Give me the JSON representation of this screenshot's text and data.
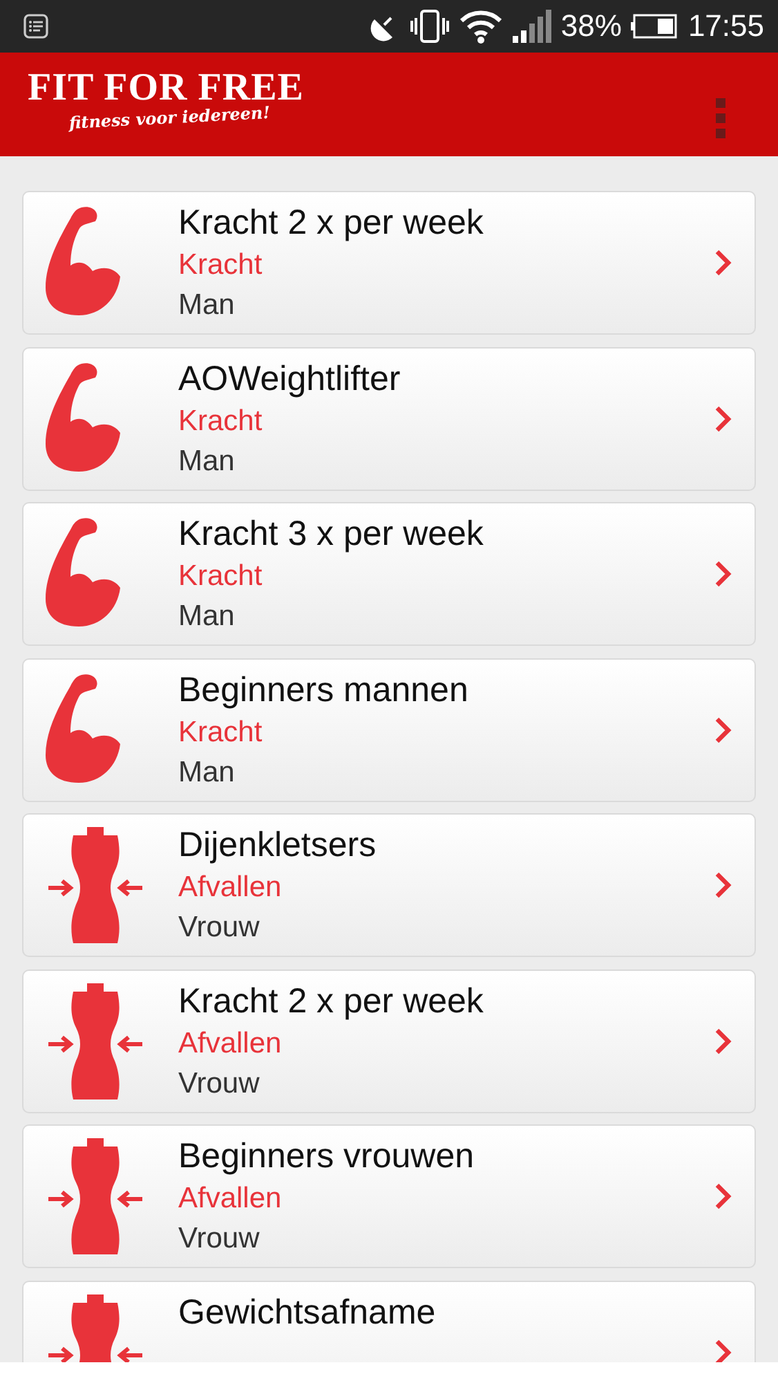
{
  "status_bar": {
    "battery": "38%",
    "time": "17:55"
  },
  "header": {
    "logo": "FIT FOR FREE",
    "tagline": "fitness voor iedereen!"
  },
  "programs": [
    {
      "kind": "muscle",
      "title": "Kracht 2 x per week",
      "category": "Kracht",
      "audience": "Man"
    },
    {
      "kind": "muscle",
      "title": "AOWeightlifter",
      "category": "Kracht",
      "audience": "Man"
    },
    {
      "kind": "muscle",
      "title": "Kracht 3 x per week",
      "category": "Kracht",
      "audience": "Man"
    },
    {
      "kind": "muscle",
      "title": "Beginners mannen",
      "category": "Kracht",
      "audience": "Man"
    },
    {
      "kind": "torso",
      "title": "Dijenkletsers",
      "category": "Afvallen",
      "audience": "Vrouw"
    },
    {
      "kind": "torso",
      "title": "Kracht 2 x per week",
      "category": "Afvallen",
      "audience": "Vrouw"
    },
    {
      "kind": "torso",
      "title": "Beginners vrouwen",
      "category": "Afvallen",
      "audience": "Vrouw"
    },
    {
      "kind": "torso",
      "title": "Gewichtsafname"
    }
  ]
}
